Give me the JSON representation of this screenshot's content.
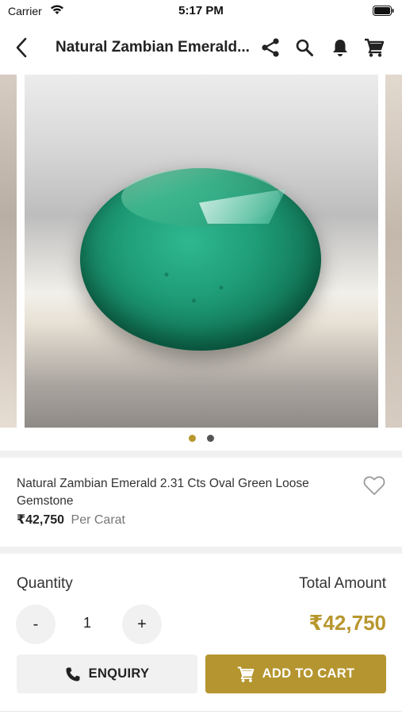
{
  "status_bar": {
    "carrier": "Carrier",
    "time": "5:17 PM"
  },
  "nav": {
    "title": "Natural Zambian Emerald...",
    "icons": [
      "back-icon",
      "share-icon",
      "search-icon",
      "bell-icon",
      "cart-icon"
    ]
  },
  "carousel": {
    "slide_count": 2,
    "active_index": 0
  },
  "product": {
    "title": "Natural Zambian Emerald 2.31 Cts Oval Green Loose Gemstone",
    "price": "₹42,750",
    "price_unit": "Per Carat"
  },
  "order": {
    "quantity_label": "Quantity",
    "quantity_value": "1",
    "decrement_label": "-",
    "increment_label": "+",
    "total_label": "Total Amount",
    "total_value": "₹42,750"
  },
  "actions": {
    "enquiry_label": "ENQUIRY",
    "cart_label": "ADD TO CART"
  },
  "colors": {
    "accent": "#b5952f",
    "total_text": "#b8972f",
    "dot_active": "#b8972f",
    "dot_inactive": "#555555",
    "button_bg": "#f1f1f1"
  }
}
